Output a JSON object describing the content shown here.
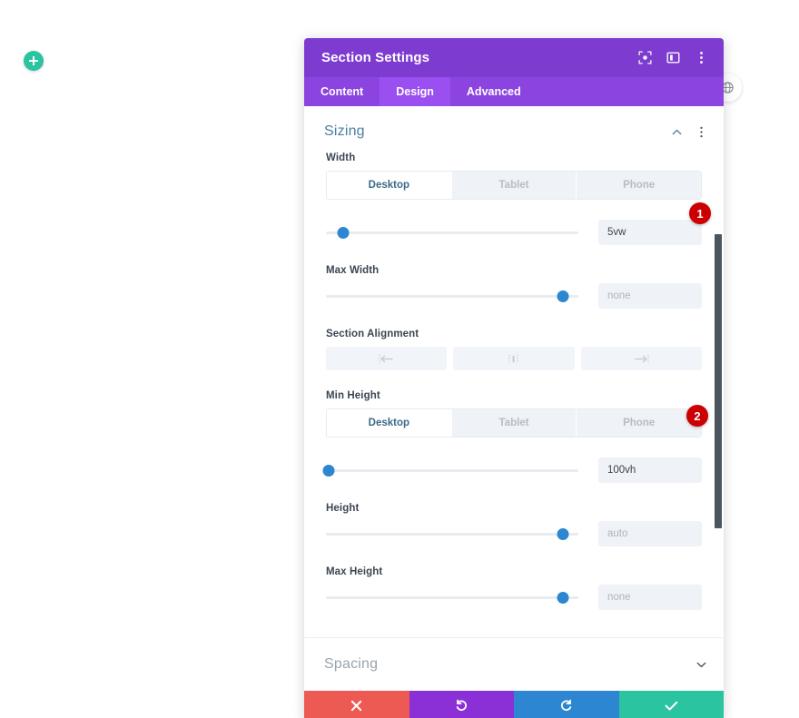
{
  "canvas": {
    "add_button": {
      "icon": "plus-icon",
      "color": "#2ac4a0"
    },
    "globe_badge": {
      "icon": "globe-icon"
    }
  },
  "modal": {
    "title": "Section Settings",
    "header_icons": [
      {
        "name": "focus-target-icon"
      },
      {
        "name": "layout-panel-icon"
      },
      {
        "name": "kebab-menu-icon"
      }
    ],
    "tabs": [
      {
        "label": "Content",
        "active": false
      },
      {
        "label": "Design",
        "active": true
      },
      {
        "label": "Advanced",
        "active": false
      }
    ],
    "sections": [
      {
        "title": "Sizing",
        "expanded": true,
        "toggle_icon": "chevron-up-icon",
        "menu_icon": "kebab-menu-icon"
      },
      {
        "title": "Spacing",
        "expanded": false,
        "toggle_icon": "chevron-down-icon"
      }
    ],
    "fields": {
      "width": {
        "label": "Width",
        "devices": [
          {
            "label": "Desktop",
            "active": true
          },
          {
            "label": "Tablet",
            "active": false
          },
          {
            "label": "Phone",
            "active": false
          }
        ],
        "slider_percent": 7,
        "value": "5vw",
        "is_placeholder": false
      },
      "max_width": {
        "label": "Max Width",
        "slider_percent": 94,
        "value": "none",
        "is_placeholder": true
      },
      "section_alignment": {
        "label": "Section Alignment",
        "options": [
          {
            "name": "align-left-icon"
          },
          {
            "name": "align-center-icon"
          },
          {
            "name": "align-right-icon"
          }
        ]
      },
      "min_height": {
        "label": "Min Height",
        "devices": [
          {
            "label": "Desktop",
            "active": true
          },
          {
            "label": "Tablet",
            "active": false
          },
          {
            "label": "Phone",
            "active": false
          }
        ],
        "slider_percent": 1,
        "value": "100vh",
        "is_placeholder": false
      },
      "height": {
        "label": "Height",
        "slider_percent": 94,
        "value": "auto",
        "is_placeholder": true
      },
      "max_height": {
        "label": "Max Height",
        "slider_percent": 94,
        "value": "none",
        "is_placeholder": true
      }
    },
    "footer": [
      {
        "name": "cancel-button",
        "icon": "close-x-icon",
        "color": "#ec5a53"
      },
      {
        "name": "undo-button",
        "icon": "undo-arrow-icon",
        "color": "#8b2fd6"
      },
      {
        "name": "redo-button",
        "icon": "redo-arrow-icon",
        "color": "#2d86d1"
      },
      {
        "name": "save-button",
        "icon": "checkmark-icon",
        "color": "#2ac4a0"
      }
    ]
  },
  "annotations": [
    {
      "label": "1"
    },
    {
      "label": "2"
    }
  ]
}
